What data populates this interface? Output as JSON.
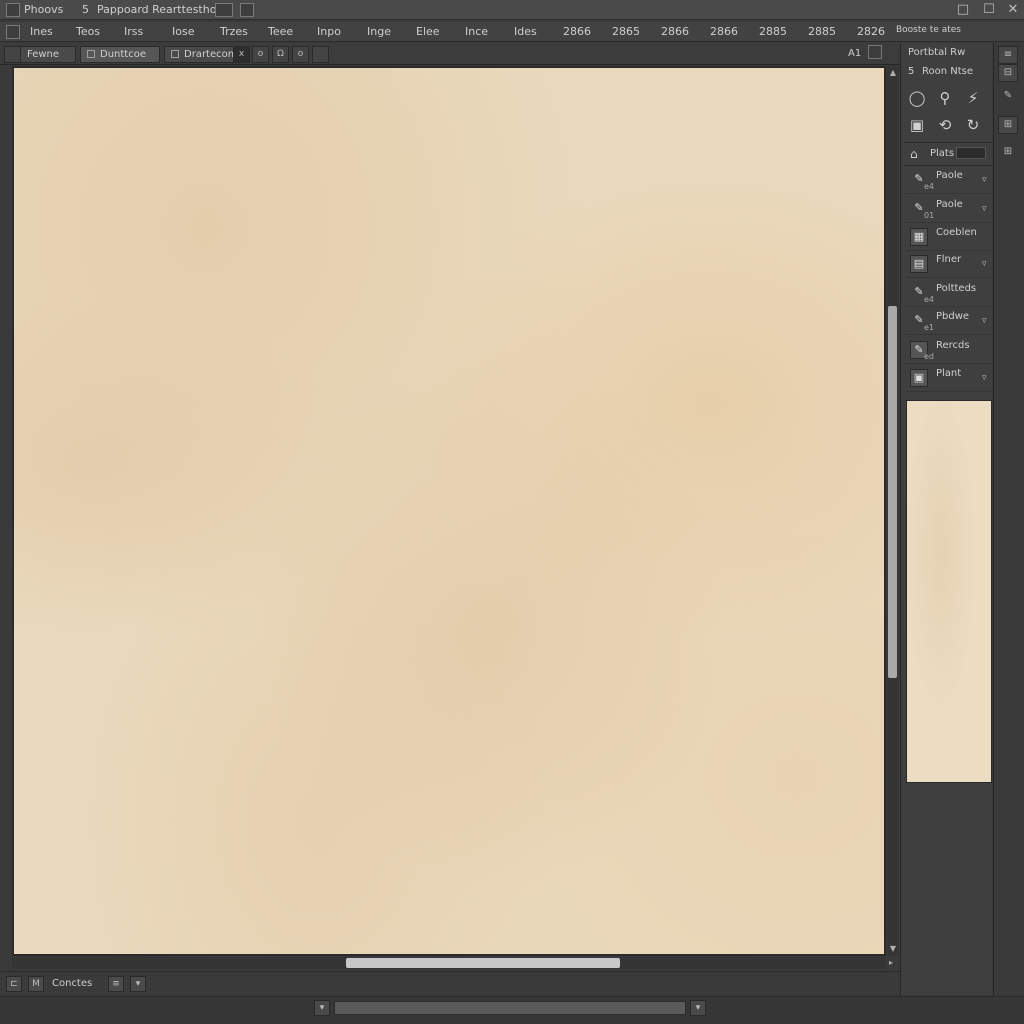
{
  "titlebar": {
    "app_label": "Phoovs",
    "doc_title": "Pappoard Rearttesthog",
    "doc_mark": "5",
    "close_glyph": "✕",
    "restore_glyph": "☐",
    "minimize_glyph": "□"
  },
  "menubar": {
    "items": [
      "Ines",
      "Teos",
      "Irss",
      "Iose",
      "Trzes",
      "Teee",
      "Inpo",
      "Inge",
      "Elee",
      "Ince",
      "Ides",
      "2866",
      "2865",
      "2866",
      "2866",
      "2885",
      "2885",
      "2826"
    ],
    "right_label": "Booste te ates"
  },
  "tabs": [
    {
      "label": "Fewne"
    },
    {
      "label": "Dunttcoe"
    },
    {
      "label": "Drartecom"
    }
  ],
  "tab_buttons": [
    "x",
    "o",
    "Ω",
    "o"
  ],
  "canvas": {
    "corner_label": "A1"
  },
  "right_panel": {
    "header": "Portbtal Rw",
    "sub": "Roon Ntse",
    "sub_number": "5",
    "tools_row1": [
      "◯",
      "⚲",
      "⚡"
    ],
    "tools_row2": [
      "▣",
      "⟲",
      "↻"
    ],
    "layers_header": "Plats",
    "layers": [
      {
        "name": "Paole",
        "sub": "e4",
        "icon": "✎",
        "caret": "▿"
      },
      {
        "name": "Paole",
        "sub": "01",
        "icon": "✎",
        "caret": "▿"
      },
      {
        "name": "Coeblen",
        "sub": "",
        "icon": "▦",
        "caret": ""
      },
      {
        "name": "Flner",
        "sub": "",
        "icon": "▤",
        "caret": "▿"
      },
      {
        "name": "Poltteds",
        "sub": "e4",
        "icon": "✎",
        "caret": ""
      },
      {
        "name": "Pbdwe",
        "sub": "e1",
        "icon": "✎",
        "caret": "▿"
      },
      {
        "name": "Rercds",
        "sub": "ed",
        "icon": "✎",
        "caret": ""
      },
      {
        "name": "Plant",
        "sub": "",
        "icon": "▣",
        "caret": "▿"
      }
    ]
  },
  "statusbar": {
    "left_icon": "⊏",
    "mode": "M",
    "label": "Conctes",
    "btn1": "≡",
    "btn2": "▾"
  },
  "strip_buttons": [
    "≡",
    "⊟",
    "✎",
    "⊞",
    "⊞"
  ]
}
